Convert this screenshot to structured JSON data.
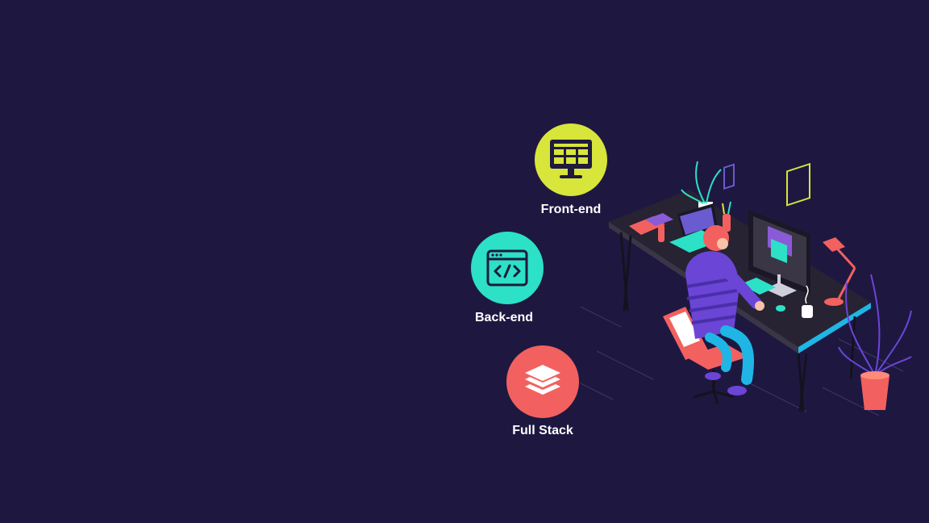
{
  "colors": {
    "background": "#1e1841",
    "frontend_badge": "#d8e53a",
    "backend_badge": "#2ce1c6",
    "fullstack_badge": "#f2615f",
    "icon_dark": "#1f1a3e",
    "label_text": "#ffffff"
  },
  "roles": [
    {
      "label": "Front-end",
      "icon": "monitor-layout-icon"
    },
    {
      "label": "Back-end",
      "icon": "code-window-icon"
    },
    {
      "label": "Full Stack",
      "icon": "layers-stack-icon"
    }
  ],
  "illustration": {
    "icon": "developer-at-desk-illustration"
  }
}
